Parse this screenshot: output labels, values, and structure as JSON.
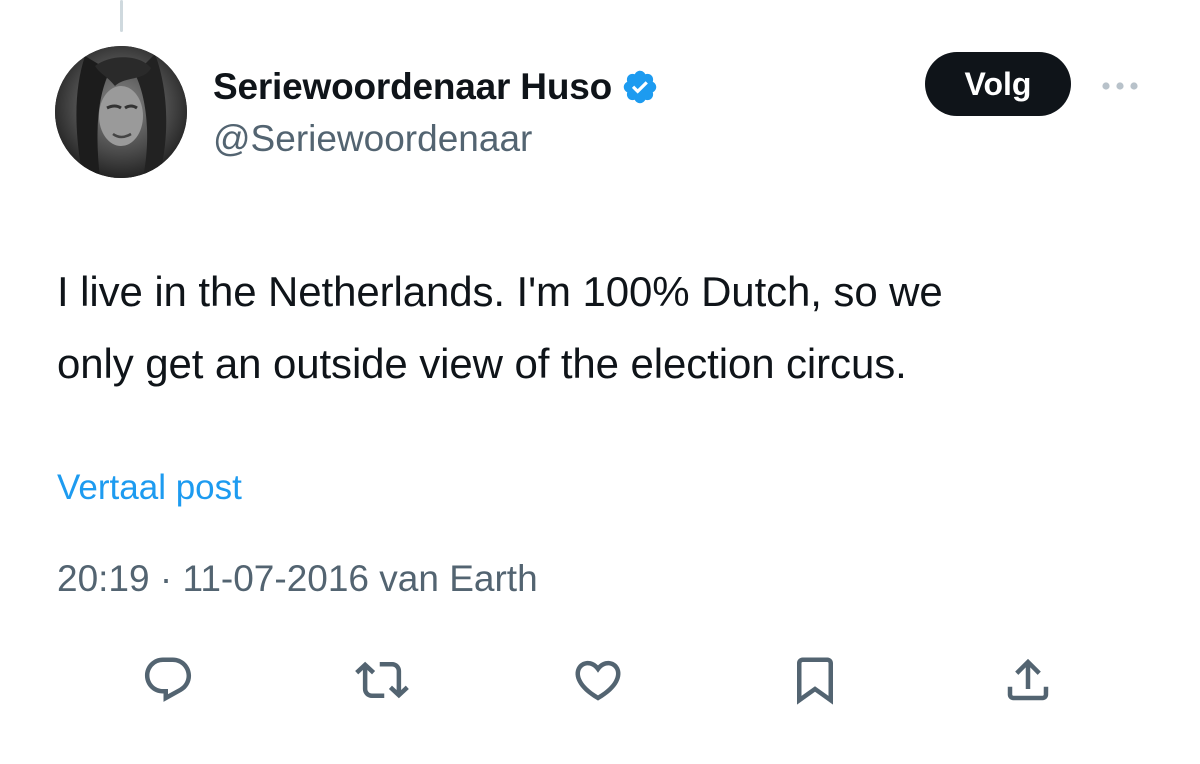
{
  "author": {
    "display_name": "Seriewoordenaar Huso",
    "handle": "@Seriewoordenaar",
    "verified": true,
    "avatar_icon": "avatar-photo"
  },
  "follow_button": {
    "label": "Volg"
  },
  "more_button": {
    "icon": "more-horizontal-icon"
  },
  "tweet": {
    "lines": [
      "I live in the Netherlands. I'm 100% Dutch, so we",
      "only get an outside view of the election circus."
    ]
  },
  "translate_link": {
    "label": "Vertaal post"
  },
  "meta": {
    "time": "20:19",
    "separator": " · ",
    "date": "11-07-2016",
    "source": " van Earth"
  },
  "actions": [
    {
      "name": "reply",
      "icon": "reply-icon"
    },
    {
      "name": "repost",
      "icon": "repost-icon"
    },
    {
      "name": "like",
      "icon": "heart-icon"
    },
    {
      "name": "bookmark",
      "icon": "bookmark-icon"
    },
    {
      "name": "share",
      "icon": "share-icon"
    }
  ],
  "colors": {
    "text": "#0f1419",
    "secondary": "#536471",
    "link": "#1d9bf0",
    "verified": "#1d9bf0",
    "follow_bg": "#0f1419",
    "divider": "#cfd9de"
  }
}
